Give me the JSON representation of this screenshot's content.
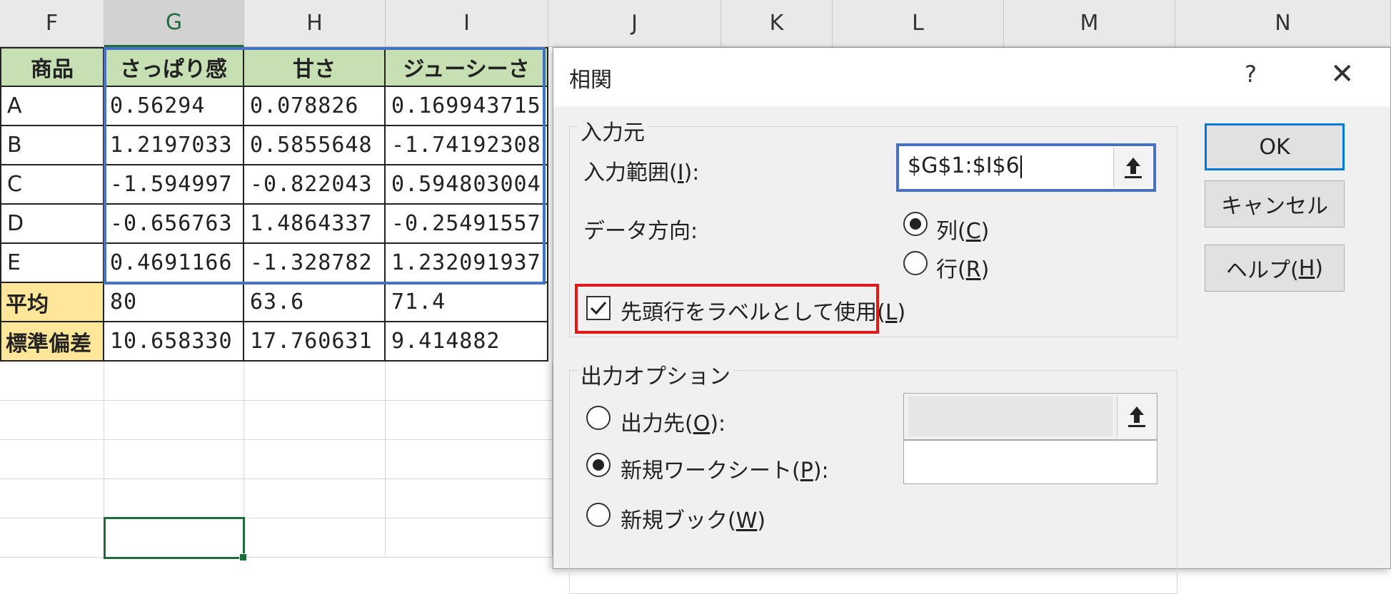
{
  "sheet": {
    "columns": [
      "F",
      "G",
      "H",
      "I",
      "J",
      "K",
      "L",
      "M",
      "N"
    ],
    "selected_column": "G",
    "table": {
      "headers": [
        "商品",
        "さっぱり感",
        "甘さ",
        "ジューシーさ"
      ],
      "rows": [
        [
          "A",
          "0.56294",
          "0.078826",
          "0.169943715"
        ],
        [
          "B",
          "1.2197033",
          "0.5855648",
          "-1.74192308"
        ],
        [
          "C",
          "-1.594997",
          "-0.822043",
          "0.594803004"
        ],
        [
          "D",
          "-0.656763",
          "1.4864337",
          "-0.25491557"
        ],
        [
          "E",
          "0.4691166",
          "-1.328782",
          "1.232091937"
        ]
      ],
      "stats": [
        [
          "平均",
          "80",
          "63.6",
          "71.4"
        ],
        [
          "標準偏差",
          "10.658330",
          "17.760631",
          "9.414882"
        ]
      ]
    },
    "colors": {
      "header_green": "#c6e0b4",
      "stat_yellow": "#ffe699",
      "range_outline": "#4472c4",
      "active_cell": "#1f6b3a"
    }
  },
  "dialog": {
    "title": "相関",
    "help": "?",
    "input_group": {
      "title": "入力元",
      "range_label_pre": "入力範囲(",
      "range_label_key": "I",
      "range_label_post": "):",
      "range_value": "$G$1:$I$6",
      "direction_label": "データ方向:",
      "opt_col_pre": "列(",
      "opt_col_key": "C",
      "opt_col_post": ")",
      "opt_row_pre": "行(",
      "opt_row_key": "R",
      "opt_row_post": ")",
      "label_check_pre": "先頭行をラベルとして使用(",
      "label_check_key": "L",
      "label_check_post": ")"
    },
    "output_group": {
      "title": "出力オプション",
      "opt_dest_pre": "出力先(",
      "opt_dest_key": "O",
      "opt_dest_post": "):",
      "opt_new_sheet_pre": "新規ワークシート(",
      "opt_new_sheet_key": "P",
      "opt_new_sheet_post": "):",
      "opt_new_book_pre": "新規ブック(",
      "opt_new_book_key": "W",
      "opt_new_book_post": ")",
      "new_sheet_value": ""
    },
    "buttons": {
      "ok": "OK",
      "cancel": "キャンセル",
      "help_pre": "ヘルプ(",
      "help_key": "H",
      "help_post": ")"
    },
    "colors": {
      "highlight_red": "#e01a1a",
      "focus_blue": "#4472c4"
    }
  }
}
